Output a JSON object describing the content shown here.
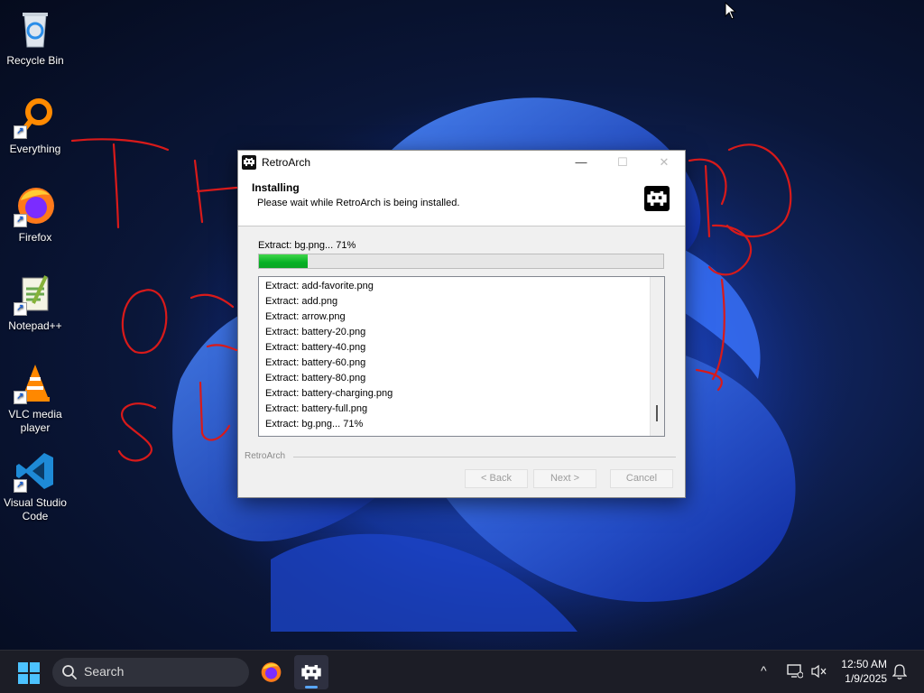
{
  "desktop": {
    "icons": [
      {
        "label": "Recycle Bin",
        "icon": "recycle-bin-icon"
      },
      {
        "label": "Everything",
        "icon": "everything-search-icon"
      },
      {
        "label": "Firefox",
        "icon": "firefox-icon"
      },
      {
        "label": "Notepad++",
        "icon": "notepad-plus-plus-icon"
      },
      {
        "label": "VLC media player",
        "icon": "vlc-icon"
      },
      {
        "label": "Visual Studio Code",
        "icon": "vscode-icon"
      }
    ],
    "annotation_color": "#d81a1a"
  },
  "window": {
    "title": "RetroArch",
    "controls": {
      "minimize": "—",
      "maximize": "☐",
      "close": "✕"
    },
    "header": {
      "title": "Installing",
      "subtitle": "Please wait while RetroArch is being installed."
    },
    "status_text": "Extract: bg.png... 71%",
    "progress": {
      "percent": 71,
      "visible_fill_fraction": 0.12,
      "color": "#06b025"
    },
    "log_lines": [
      "Extract: add-favorite.png",
      "Extract: add.png",
      "Extract: arrow.png",
      "Extract: battery-20.png",
      "Extract: battery-40.png",
      "Extract: battery-60.png",
      "Extract: battery-80.png",
      "Extract: battery-charging.png",
      "Extract: battery-full.png",
      "Extract: bg.png... 71%"
    ],
    "brand": "RetroArch",
    "buttons": {
      "back": "< Back",
      "next": "Next >",
      "cancel": "Cancel"
    }
  },
  "taskbar": {
    "search_placeholder": "Search",
    "pinned": [
      {
        "name": "firefox-taskbar-icon"
      },
      {
        "name": "retroarch-taskbar-icon",
        "active": true
      }
    ],
    "tray": {
      "chevron": "^"
    },
    "clock": {
      "time": "12:50 AM",
      "date": "1/9/2025"
    }
  }
}
